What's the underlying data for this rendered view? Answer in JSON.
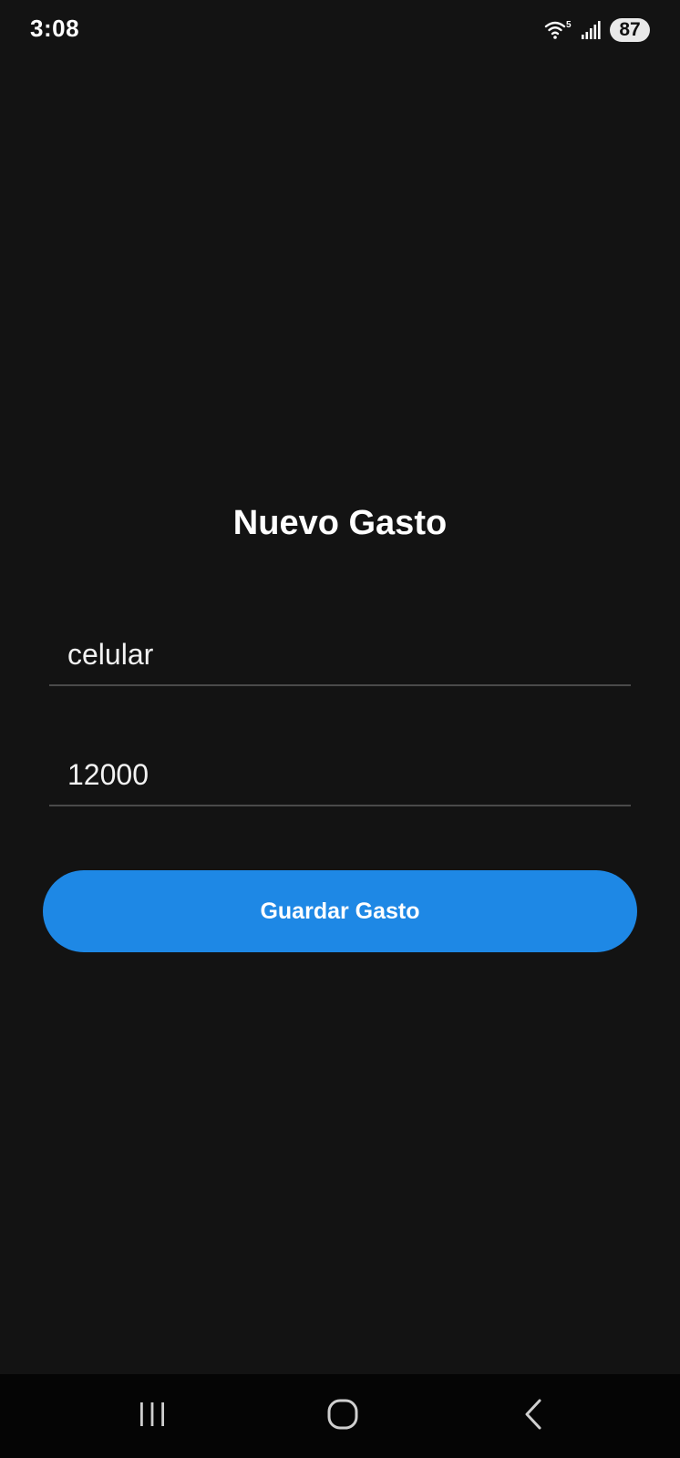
{
  "status_bar": {
    "time": "3:08",
    "wifi_icon": "wifi-5-icon",
    "wifi_label": "5",
    "signal_icon": "cell-signal-icon",
    "battery_level": "87"
  },
  "form": {
    "title": "Nuevo Gasto",
    "name_value": "celular",
    "amount_value": "12000",
    "save_label": "Guardar Gasto"
  },
  "nav_bar": {
    "recents_icon": "recents-icon",
    "home_icon": "home-icon",
    "back_icon": "back-icon"
  },
  "colors": {
    "background": "#131313",
    "accent": "#1e88e5",
    "divider": "#4a4a4a",
    "nav_background": "#050505"
  }
}
